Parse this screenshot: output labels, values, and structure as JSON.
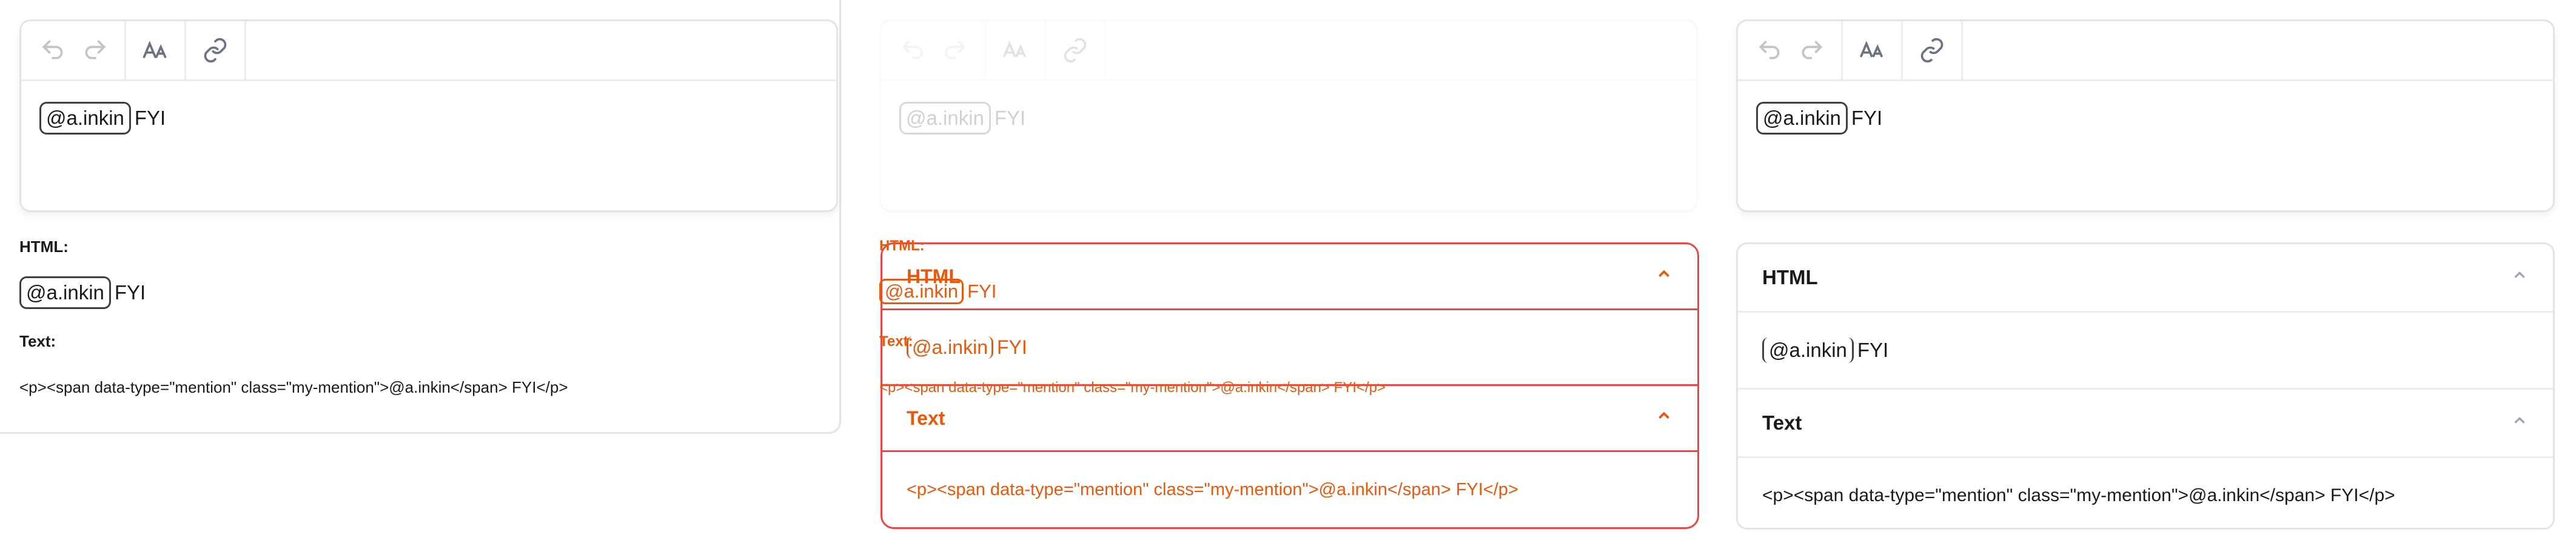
{
  "editor": {
    "mention": "@a.inkin",
    "trailing_text": "FYI"
  },
  "labels": {
    "html": "HTML:",
    "text": "Text:"
  },
  "output": {
    "text_serialized": "<p><span data-type=\"mention\" class=\"my-mention\">@a.inkin</span> FYI</p>"
  },
  "accordion": {
    "html_title": "HTML",
    "text_title": "Text"
  },
  "toolbar": {
    "icons": [
      "undo-icon",
      "redo-icon",
      "font-size-icon",
      "link-icon"
    ]
  },
  "colors": {
    "overlay_orange": "#ea580c",
    "overlay_red": "#ef4444",
    "border": "#e4e4e7"
  }
}
